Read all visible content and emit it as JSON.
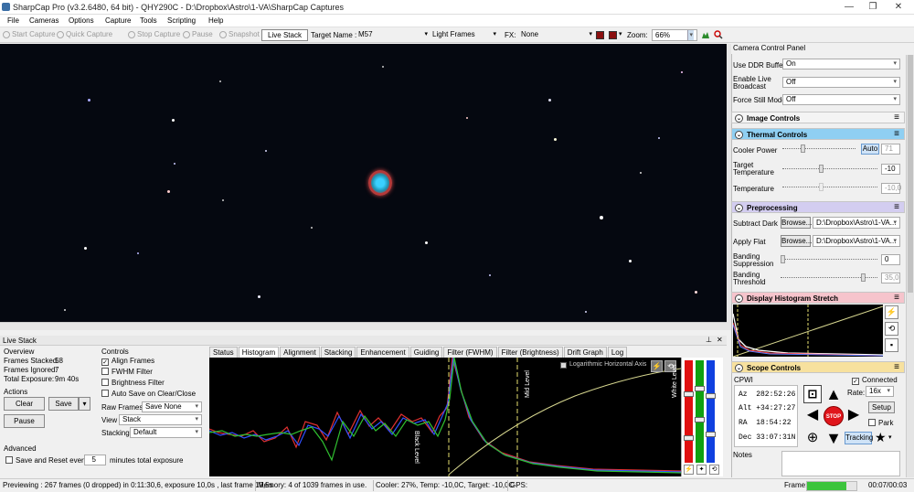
{
  "window": {
    "title": "SharpCap Pro (v3.2.6480, 64 bit) - QHY290C - D:\\Dropbox\\Astro\\1-VA\\SharpCap Captures",
    "minimize": "—",
    "maximize": "❐",
    "close": "✕"
  },
  "menu": [
    "File",
    "Cameras",
    "Options",
    "Capture",
    "Tools",
    "Scripting",
    "Help"
  ],
  "toolbar": {
    "start_capture": "Start Capture",
    "quick_capture": "Quick Capture",
    "stop_capture": "Stop Capture",
    "pause": "Pause",
    "snapshot": "Snapshot",
    "live_stack": "Live Stack",
    "target_label": "Target Name :",
    "target_value": "M57",
    "frame_type": "Light Frames",
    "fx_label": "FX:",
    "fx_value": "None",
    "zoom_label": "Zoom:",
    "zoom_value": "66%"
  },
  "live_stack": {
    "title": "Live Stack",
    "overview_title": "Overview",
    "frames_stacked_label": "Frames Stacked:",
    "frames_stacked": "58",
    "frames_ignored_label": "Frames Ignored:",
    "frames_ignored": "7",
    "total_exposure_label": "Total Exposure:",
    "total_exposure": "9m 40s",
    "actions_title": "Actions",
    "clear": "Clear",
    "save": "Save",
    "pause": "Pause",
    "advanced_title": "Advanced",
    "save_reset_label": "Save and Reset every",
    "save_reset_value": "5",
    "save_reset_suffix": "minutes total exposure",
    "controls_title": "Controls",
    "align_frames": "Align Frames",
    "fwhm_filter": "FWHM Filter",
    "brightness_filter": "Brightness Filter",
    "auto_save": "Auto Save on Clear/Close",
    "raw_frames_label": "Raw Frames",
    "raw_frames_value": "Save None",
    "view_label": "View",
    "view_value": "Stack",
    "stacking_label": "Stacking",
    "stacking_value": "Default"
  },
  "tabs": [
    "Status",
    "Histogram",
    "Alignment",
    "Stacking",
    "Enhancement",
    "Guiding",
    "Filter (FWHM)",
    "Filter (Brightness)",
    "Drift Graph",
    "Log"
  ],
  "histogram": {
    "log_axis_label": "Logarithmic Horizontal Axis",
    "black_level": "Black Level",
    "mid_level": "Mid Level",
    "white_level": "White Level"
  },
  "panel": {
    "title": "Camera Control Panel",
    "use_ddr_label": "Use DDR Buffer",
    "use_ddr_value": "On",
    "live_broadcast_label": "Enable Live Broadcast",
    "live_broadcast_value": "Off",
    "force_still_label": "Force Still Mode",
    "force_still_value": "Off",
    "image_controls": "Image Controls",
    "thermal_controls": "Thermal Controls",
    "cooler_power_label": "Cooler Power",
    "cooler_auto": "Auto",
    "cooler_power_value": "71",
    "target_temp_label": "Target Temperature",
    "target_temp_value": "-10",
    "temperature_label": "Temperature",
    "temperature_value": "-10,0",
    "preprocessing": "Preprocessing",
    "subtract_dark_label": "Subtract Dark",
    "browse": "Browse...",
    "subtract_dark_path": "D:\\Dropbox\\Astro\\1-VA...",
    "apply_flat_label": "Apply Flat",
    "apply_flat_path": "D:\\Dropbox\\Astro\\1-VA...",
    "banding_supp_label": "Banding Suppression",
    "banding_supp_value": "0",
    "banding_thresh_label": "Banding Threshold",
    "banding_thresh_value": "35,0",
    "display_stretch": "Display Histogram Stretch",
    "scope_controls": "Scope Controls",
    "scope_name": "CPWI",
    "connected": "Connected",
    "az": "Az  282:52:26",
    "alt": "Alt +34:27:27",
    "ra": "RA  18:54:22",
    "dec": "Dec 33:07:31N",
    "rate_label": "Rate:",
    "rate_value": "16x",
    "setup": "Setup",
    "park": "Park",
    "tracking": "Tracking",
    "stop": "STOP",
    "notes_label": "Notes"
  },
  "status": {
    "preview": "Previewing : 267 frames (0 dropped) in 0:11:30,6, exposure 10,0s , last frame 19,5s",
    "memory": "Memory: 4 of 1039 frames in use.",
    "cooler": "Cooler: 27%, Temp: -10,0C, Target: -10,0C",
    "gps": "GPS:",
    "frame_label": "Frame:",
    "frame_time": "00:07/00:03",
    "frame_progress": 0.8
  },
  "colors": {
    "thermal_header": "#8fcff2",
    "preprocessing_header": "#d3cdf0",
    "stretch_header": "#f6c4cc",
    "scope_header": "#f7e19e",
    "progress": "#3cc43c",
    "stop": "#e0151b"
  }
}
